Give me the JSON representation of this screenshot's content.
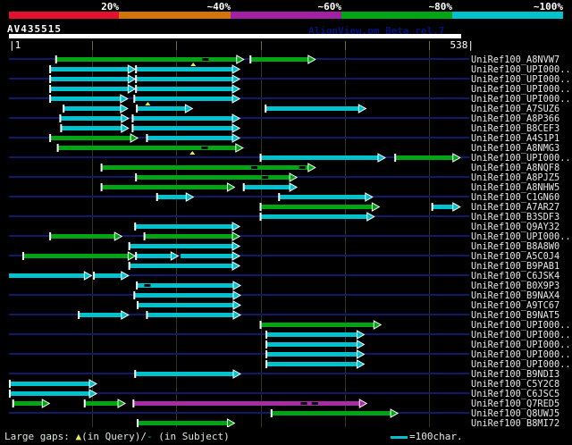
{
  "window": {
    "title": "AV435515",
    "watermark": "AlignView.pm Beta rel.7"
  },
  "ruler": {
    "start_label": "|1",
    "end_label": "538|"
  },
  "legend": {
    "gaps_prefix": "Large gaps: ",
    "query_gap_symbol": "▲",
    "query_gap_text": "(in Query)/",
    "subject_gap_symbol": "-",
    "subject_gap_text": " (in Subject)",
    "scale_text": "=100char."
  },
  "chart_data": {
    "type": "bar",
    "subtype": "sequence-alignment-overview",
    "title": "AV435515",
    "query": {
      "name": "AV435515",
      "start": 1,
      "end": 538
    },
    "x_axis": {
      "min": 1,
      "max": 538,
      "gridlines": [
        100,
        200,
        300,
        400,
        500
      ]
    },
    "identity_key": [
      {
        "label": "20%",
        "color": "#e4112e"
      },
      {
        "label": "~40%",
        "color": "#d2730c"
      },
      {
        "label": "~60%",
        "color": "#a021a3"
      },
      {
        "label": "~80%",
        "color": "#00a513"
      },
      {
        "label": "~100%",
        "color": "#00c2ce"
      }
    ],
    "color_classes": {
      "green": "#00a513",
      "cyan": "#00c2ce",
      "purple": "#a82ba8"
    },
    "rows": [
      {
        "label": "UniRef100_A8NVW7",
        "segments": [
          {
            "start": 57,
            "end": 279,
            "cls": "green",
            "tick": true
          },
          {
            "start": 288,
            "end": 364,
            "cls": "green",
            "tick": true
          }
        ],
        "query_gaps": [
          220
        ],
        "subject_gaps": [
          234
        ]
      },
      {
        "label": "UniRef100_UPI000..",
        "segments": [
          {
            "start": 50,
            "end": 150,
            "cls": "cyan",
            "tick": true
          },
          {
            "start": 152,
            "end": 274,
            "cls": "cyan",
            "tick": true
          }
        ],
        "query_gaps": [],
        "subject_gaps": []
      },
      {
        "label": "UniRef100_UPI000..",
        "segments": [
          {
            "start": 50,
            "end": 150,
            "cls": "cyan",
            "tick": true
          },
          {
            "start": 152,
            "end": 274,
            "cls": "cyan",
            "tick": true
          }
        ],
        "query_gaps": [],
        "subject_gaps": []
      },
      {
        "label": "UniRef100_UPI000..",
        "segments": [
          {
            "start": 50,
            "end": 150,
            "cls": "cyan",
            "tick": true
          },
          {
            "start": 152,
            "end": 274,
            "cls": "cyan",
            "tick": true
          }
        ],
        "query_gaps": [],
        "subject_gaps": []
      },
      {
        "label": "UniRef100_UPI000..",
        "segments": [
          {
            "start": 50,
            "end": 141,
            "cls": "cyan",
            "tick": true
          },
          {
            "start": 150,
            "end": 274,
            "cls": "cyan",
            "tick": true
          }
        ],
        "query_gaps": [
          166
        ],
        "subject_gaps": []
      },
      {
        "label": "UniRef100_A7SUZ6",
        "segments": [
          {
            "start": 66,
            "end": 141,
            "cls": "cyan",
            "tick": true
          },
          {
            "start": 153,
            "end": 218,
            "cls": "cyan",
            "tick": true
          },
          {
            "start": 306,
            "end": 424,
            "cls": "cyan",
            "tick": true
          }
        ],
        "query_gaps": [],
        "subject_gaps": []
      },
      {
        "label": "UniRef100_A8P366",
        "segments": [
          {
            "start": 62,
            "end": 142,
            "cls": "cyan",
            "tick": true
          },
          {
            "start": 148,
            "end": 274,
            "cls": "cyan",
            "tick": true
          }
        ],
        "query_gaps": [],
        "subject_gaps": []
      },
      {
        "label": "UniRef100_B8CEF3",
        "segments": [
          {
            "start": 63,
            "end": 142,
            "cls": "cyan",
            "tick": true
          },
          {
            "start": 148,
            "end": 274,
            "cls": "cyan",
            "tick": true
          }
        ],
        "query_gaps": [],
        "subject_gaps": []
      },
      {
        "label": "UniRef100_A4S1P1",
        "segments": [
          {
            "start": 50,
            "end": 153,
            "cls": "green",
            "tick": true
          },
          {
            "start": 165,
            "end": 274,
            "cls": "cyan",
            "tick": true
          }
        ],
        "query_gaps": [],
        "subject_gaps": []
      },
      {
        "label": "UniRef100_A8NMG3",
        "segments": [
          {
            "start": 59,
            "end": 278,
            "cls": "green",
            "tick": true
          }
        ],
        "query_gaps": [
          219
        ],
        "subject_gaps": [
          233
        ]
      },
      {
        "label": "UniRef100_UPI000..",
        "segments": [
          {
            "start": 300,
            "end": 447,
            "cls": "cyan",
            "tick": true
          },
          {
            "start": 460,
            "end": 536,
            "cls": "green",
            "tick": true
          }
        ],
        "query_gaps": [],
        "subject_gaps": []
      },
      {
        "label": "UniRef100_A8NQF8",
        "segments": [
          {
            "start": 111,
            "end": 364,
            "cls": "green",
            "tick": true
          }
        ],
        "query_gaps": [],
        "subject_gaps": [
          292,
          349
        ]
      },
      {
        "label": "UniRef100_A8PJZ5",
        "segments": [
          {
            "start": 152,
            "end": 342,
            "cls": "green",
            "tick": true
          }
        ],
        "query_gaps": [],
        "subject_gaps": [
          305
        ]
      },
      {
        "label": "UniRef100_A8NHW5",
        "segments": [
          {
            "start": 111,
            "end": 268,
            "cls": "green",
            "tick": true
          },
          {
            "start": 280,
            "end": 342,
            "cls": "cyan",
            "tick": true
          }
        ],
        "query_gaps": [],
        "subject_gaps": []
      },
      {
        "label": "UniRef100_C1GN60",
        "segments": [
          {
            "start": 177,
            "end": 219,
            "cls": "cyan",
            "tick": true
          },
          {
            "start": 322,
            "end": 432,
            "cls": "cyan",
            "tick": true
          }
        ],
        "query_gaps": [],
        "subject_gaps": []
      },
      {
        "label": "UniRef100_A7AR27",
        "segments": [
          {
            "start": 300,
            "end": 440,
            "cls": "green",
            "tick": true
          },
          {
            "start": 504,
            "end": 536,
            "cls": "cyan",
            "tick": true
          }
        ],
        "query_gaps": [],
        "subject_gaps": []
      },
      {
        "label": "UniRef100_B3SDF3",
        "segments": [
          {
            "start": 300,
            "end": 434,
            "cls": "cyan",
            "tick": true
          }
        ],
        "query_gaps": [],
        "subject_gaps": []
      },
      {
        "label": "UniRef100_Q9AY32",
        "segments": [
          {
            "start": 151,
            "end": 274,
            "cls": "cyan",
            "tick": true
          }
        ],
        "query_gaps": [],
        "subject_gaps": []
      },
      {
        "label": "UniRef100_UPI000..",
        "segments": [
          {
            "start": 50,
            "end": 134,
            "cls": "green",
            "tick": true
          },
          {
            "start": 162,
            "end": 274,
            "cls": "green",
            "tick": true
          }
        ],
        "query_gaps": [],
        "subject_gaps": []
      },
      {
        "label": "UniRef100_B8A8W0",
        "segments": [
          {
            "start": 144,
            "end": 274,
            "cls": "cyan",
            "tick": true
          }
        ],
        "query_gaps": [],
        "subject_gaps": []
      },
      {
        "label": "UniRef100_A5C0J4",
        "segments": [
          {
            "start": 18,
            "end": 150,
            "cls": "green",
            "tick": true
          },
          {
            "start": 152,
            "end": 201,
            "cls": "cyan",
            "tick": true
          },
          {
            "start": 205,
            "end": 274,
            "cls": "cyan",
            "tick": false
          }
        ],
        "query_gaps": [],
        "subject_gaps": []
      },
      {
        "label": "UniRef100_B9PAB1",
        "segments": [
          {
            "start": 144,
            "end": 274,
            "cls": "cyan",
            "tick": true
          }
        ],
        "query_gaps": [],
        "subject_gaps": []
      },
      {
        "label": "UniRef100_C6JSK4",
        "segments": [
          {
            "start": 1,
            "end": 98,
            "cls": "cyan",
            "tick": false
          },
          {
            "start": 102,
            "end": 142,
            "cls": "cyan",
            "tick": true
          }
        ],
        "query_gaps": [],
        "subject_gaps": []
      },
      {
        "label": "UniRef100_B0X9P3",
        "segments": [
          {
            "start": 153,
            "end": 275,
            "cls": "cyan",
            "tick": true
          }
        ],
        "query_gaps": [],
        "subject_gaps": [
          165
        ]
      },
      {
        "label": "UniRef100_B9NAX4",
        "segments": [
          {
            "start": 150,
            "end": 275,
            "cls": "cyan",
            "tick": true
          }
        ],
        "query_gaps": [],
        "subject_gaps": []
      },
      {
        "label": "UniRef100_A9TC67",
        "segments": [
          {
            "start": 154,
            "end": 275,
            "cls": "cyan",
            "tick": true
          }
        ],
        "query_gaps": [],
        "subject_gaps": []
      },
      {
        "label": "UniRef100_B9NAT5",
        "segments": [
          {
            "start": 84,
            "end": 142,
            "cls": "cyan",
            "tick": true
          },
          {
            "start": 165,
            "end": 275,
            "cls": "cyan",
            "tick": true
          }
        ],
        "query_gaps": [],
        "subject_gaps": []
      },
      {
        "label": "UniRef100_UPI000..",
        "segments": [
          {
            "start": 300,
            "end": 442,
            "cls": "green",
            "tick": true
          }
        ],
        "query_gaps": [],
        "subject_gaps": []
      },
      {
        "label": "UniRef100_UPI000..",
        "segments": [
          {
            "start": 307,
            "end": 422,
            "cls": "cyan",
            "tick": true
          }
        ],
        "query_gaps": [],
        "subject_gaps": []
      },
      {
        "label": "UniRef100_UPI000..",
        "segments": [
          {
            "start": 307,
            "end": 422,
            "cls": "cyan",
            "tick": true
          }
        ],
        "query_gaps": [],
        "subject_gaps": []
      },
      {
        "label": "UniRef100_UPI000..",
        "segments": [
          {
            "start": 307,
            "end": 422,
            "cls": "cyan",
            "tick": true
          }
        ],
        "query_gaps": [],
        "subject_gaps": []
      },
      {
        "label": "UniRef100_UPI000..",
        "segments": [
          {
            "start": 307,
            "end": 422,
            "cls": "cyan",
            "tick": true
          }
        ],
        "query_gaps": [],
        "subject_gaps": []
      },
      {
        "label": "UniRef100_B9NDI3",
        "segments": [
          {
            "start": 151,
            "end": 275,
            "cls": "cyan",
            "tick": true
          }
        ],
        "query_gaps": [],
        "subject_gaps": []
      },
      {
        "label": "UniRef100_C5Y2C8",
        "segments": [
          {
            "start": 2,
            "end": 104,
            "cls": "cyan",
            "tick": true
          }
        ],
        "query_gaps": [],
        "subject_gaps": []
      },
      {
        "label": "UniRef100_C6JSC5",
        "segments": [
          {
            "start": 2,
            "end": 104,
            "cls": "cyan",
            "tick": true
          }
        ],
        "query_gaps": [],
        "subject_gaps": []
      },
      {
        "label": "UniRef100_Q7RED5",
        "segments": [
          {
            "start": 6,
            "end": 48,
            "cls": "green",
            "tick": true
          },
          {
            "start": 91,
            "end": 138,
            "cls": "green",
            "tick": true
          },
          {
            "start": 149,
            "end": 425,
            "cls": "purple",
            "tick": true
          }
        ],
        "query_gaps": [],
        "subject_gaps": [
          351,
          364
        ]
      },
      {
        "label": "UniRef100_Q8UWJ5",
        "segments": [
          {
            "start": 313,
            "end": 462,
            "cls": "green",
            "tick": true
          }
        ],
        "query_gaps": [],
        "subject_gaps": []
      },
      {
        "label": "UniRef100_B8MI72",
        "segments": [
          {
            "start": 154,
            "end": 268,
            "cls": "green",
            "tick": true
          }
        ],
        "query_gaps": [],
        "subject_gaps": []
      }
    ]
  }
}
